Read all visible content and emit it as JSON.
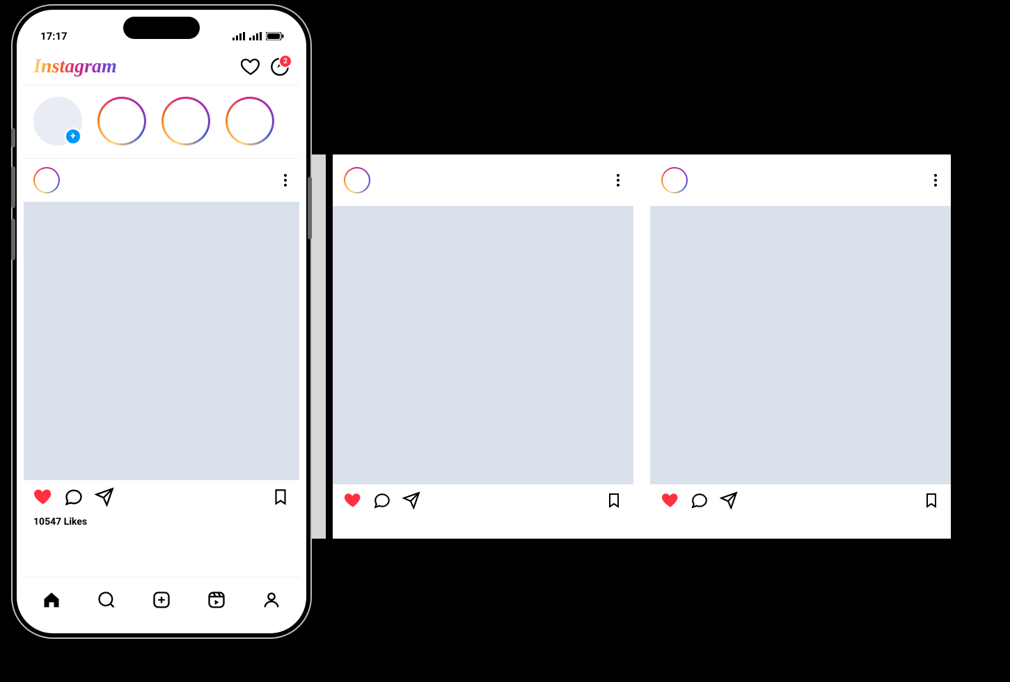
{
  "status": {
    "time": "17:17"
  },
  "header": {
    "logo": "Instagram",
    "dm_badge": "2"
  },
  "post": {
    "likes_count": "10547",
    "likes_suffix": "Likes"
  }
}
